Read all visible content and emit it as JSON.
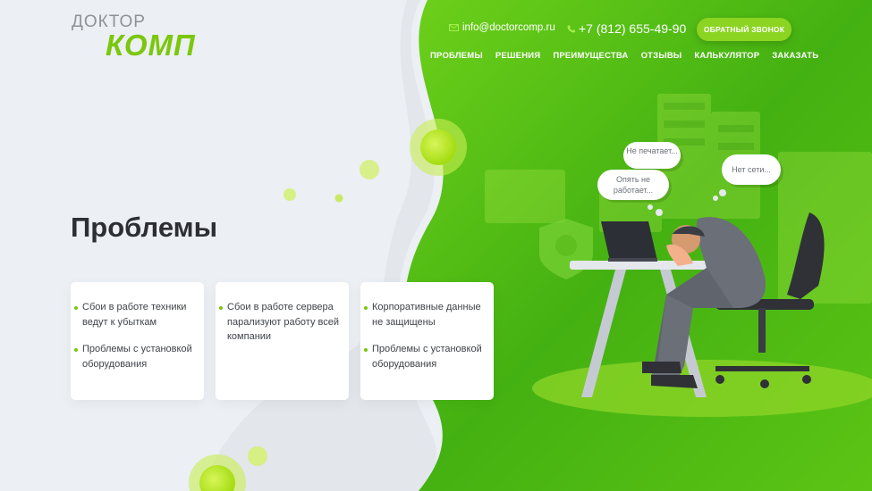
{
  "logo": {
    "top": "ДОКТОР",
    "main": "КОМП"
  },
  "header": {
    "email": "info@doctorcomp.ru",
    "phone": "+7 (812) 655-49-90",
    "callback_label": "ОБРАТНЫЙ ЗВОНОК",
    "email_icon": "mail-icon",
    "phone_icon": "phone-icon"
  },
  "nav": {
    "items": [
      {
        "label": "ПРОБЛЕМЫ"
      },
      {
        "label": "РЕШЕНИЯ"
      },
      {
        "label": "ПРЕИМУЩЕСТВА"
      },
      {
        "label": "ОТЗЫВЫ"
      },
      {
        "label": "КАЛЬКУЛЯТОР"
      },
      {
        "label": "ЗАКАЗАТЬ"
      }
    ]
  },
  "main": {
    "title": "Проблемы",
    "cards": [
      {
        "items": [
          "Сбои в работе техники ведут к убыткам",
          "Проблемы с установкой оборудования"
        ]
      },
      {
        "items": [
          "Сбои в работе сервера парализуют работу всей компании"
        ]
      },
      {
        "items": [
          "Корпоративные данные не защищены",
          "Проблемы с установкой оборудования"
        ]
      }
    ]
  },
  "illustration": {
    "bubbles": [
      {
        "text": "Не печатает..."
      },
      {
        "text": "Опять не работает..."
      },
      {
        "text": "Нет сети..."
      }
    ]
  },
  "colors": {
    "brand_green": "#7ac70c",
    "button_green": "#8cd422",
    "bg_green": "#4bb50e",
    "text_dark": "#2d2f33"
  }
}
